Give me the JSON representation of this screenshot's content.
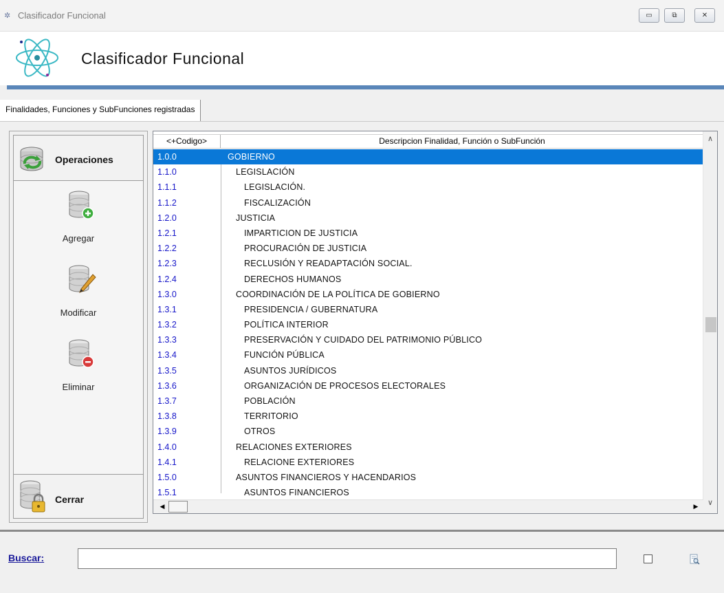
{
  "window": {
    "title": "Clasificador Funcional",
    "app_icon_glyph": "✲",
    "minimize_glyph": "▭",
    "restore_glyph": "⧉",
    "close_glyph": "✕"
  },
  "header": {
    "title": "Clasificador Funcional"
  },
  "tab": {
    "label": "Finalidades, Funciones y SubFunciones registradas"
  },
  "left_panel": {
    "operations_label": "Operaciones",
    "add_label": "Agregar",
    "modify_label": "Modificar",
    "delete_label": "Eliminar",
    "close_label": "Cerrar"
  },
  "grid": {
    "columns": [
      "<+Codigo>",
      "Descripcion Finalidad, Función o SubFunción"
    ],
    "selected_index": 0,
    "rows": [
      {
        "code": "1.0.0",
        "desc": "GOBIERNO",
        "level": 0
      },
      {
        "code": "1.1.0",
        "desc": "LEGISLACIÓN",
        "level": 1
      },
      {
        "code": "1.1.1",
        "desc": "LEGISLACIÓN.",
        "level": 2
      },
      {
        "code": "1.1.2",
        "desc": "FISCALIZACIÓN",
        "level": 2
      },
      {
        "code": "1.2.0",
        "desc": "JUSTICIA",
        "level": 1
      },
      {
        "code": "1.2.1",
        "desc": "IMPARTICION DE JUSTICIA",
        "level": 2
      },
      {
        "code": "1.2.2",
        "desc": "PROCURACIÓN DE JUSTICIA",
        "level": 2
      },
      {
        "code": "1.2.3",
        "desc": "RECLUSIÓN Y READAPTACIÓN SOCIAL.",
        "level": 2
      },
      {
        "code": "1.2.4",
        "desc": "DERECHOS HUMANOS",
        "level": 2
      },
      {
        "code": "1.3.0",
        "desc": "COORDINACIÓN DE LA POLÍTICA DE GOBIERNO",
        "level": 1
      },
      {
        "code": "1.3.1",
        "desc": "PRESIDENCIA / GUBERNATURA",
        "level": 2
      },
      {
        "code": "1.3.2",
        "desc": "POLÍTICA INTERIOR",
        "level": 2
      },
      {
        "code": "1.3.3",
        "desc": "PRESERVACIÓN Y CUIDADO DEL PATRIMONIO PÚBLICO",
        "level": 2
      },
      {
        "code": "1.3.4",
        "desc": "FUNCIÓN PÚBLICA",
        "level": 2
      },
      {
        "code": "1.3.5",
        "desc": "ASUNTOS JURÍDICOS",
        "level": 2
      },
      {
        "code": "1.3.6",
        "desc": "ORGANIZACIÓN DE PROCESOS ELECTORALES",
        "level": 2
      },
      {
        "code": "1.3.7",
        "desc": "POBLACIÓN",
        "level": 2
      },
      {
        "code": "1.3.8",
        "desc": "TERRITORIO",
        "level": 2
      },
      {
        "code": "1.3.9",
        "desc": "OTROS",
        "level": 2
      },
      {
        "code": "1.4.0",
        "desc": "RELACIONES EXTERIORES",
        "level": 1
      },
      {
        "code": "1.4.1",
        "desc": "RELACIONE EXTERIORES",
        "level": 2
      },
      {
        "code": "1.5.0",
        "desc": "ASUNTOS FINANCIEROS Y HACENDARIOS",
        "level": 1
      },
      {
        "code": "1.5.1",
        "desc": "ASUNTOS FINANCIEROS",
        "level": 2
      }
    ]
  },
  "scroll": {
    "up_glyph": "∧",
    "down_glyph": "∨",
    "left_glyph": "◀",
    "right_glyph": "▶"
  },
  "search": {
    "label": "Buscar:",
    "value": "",
    "placeholder": ""
  },
  "colors": {
    "selection": "#0a78d7",
    "code_text": "#1414c8",
    "header_bar": "#5a86b9"
  }
}
